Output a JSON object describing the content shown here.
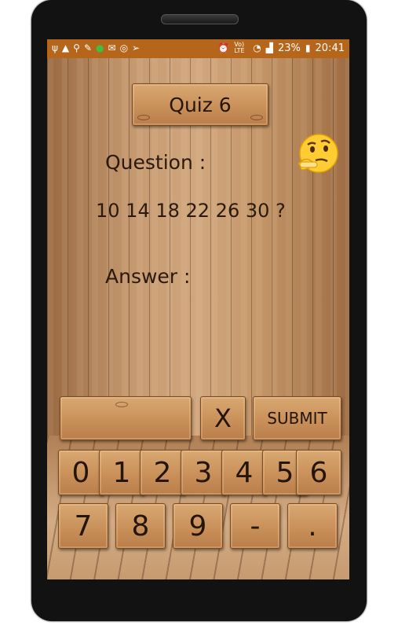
{
  "status_bar": {
    "icons": [
      "usb-icon",
      "warning-icon",
      "bag-icon",
      "signature-icon",
      "chat-icon",
      "mail-icon",
      "whatsapp-icon",
      "send-icon"
    ],
    "alarm": "⏰",
    "network": "Vo) LTE",
    "battery": "23%",
    "time": "20:41"
  },
  "title": "Quiz 6",
  "question_label": "Question :",
  "sequence": "10 14 18 22 26 30  ?",
  "answer_label": "Answer :",
  "answer_value": "",
  "clear_label": "X",
  "submit_label": "SUBMIT",
  "keys_row1": [
    "0",
    "1",
    "2",
    "3",
    "4",
    "5",
    "6"
  ],
  "keys_row2": [
    "7",
    "8",
    "9",
    "-",
    "."
  ],
  "colors": {
    "status_bar": "#b6661b",
    "plank": "#c88e58",
    "text": "#231508"
  }
}
